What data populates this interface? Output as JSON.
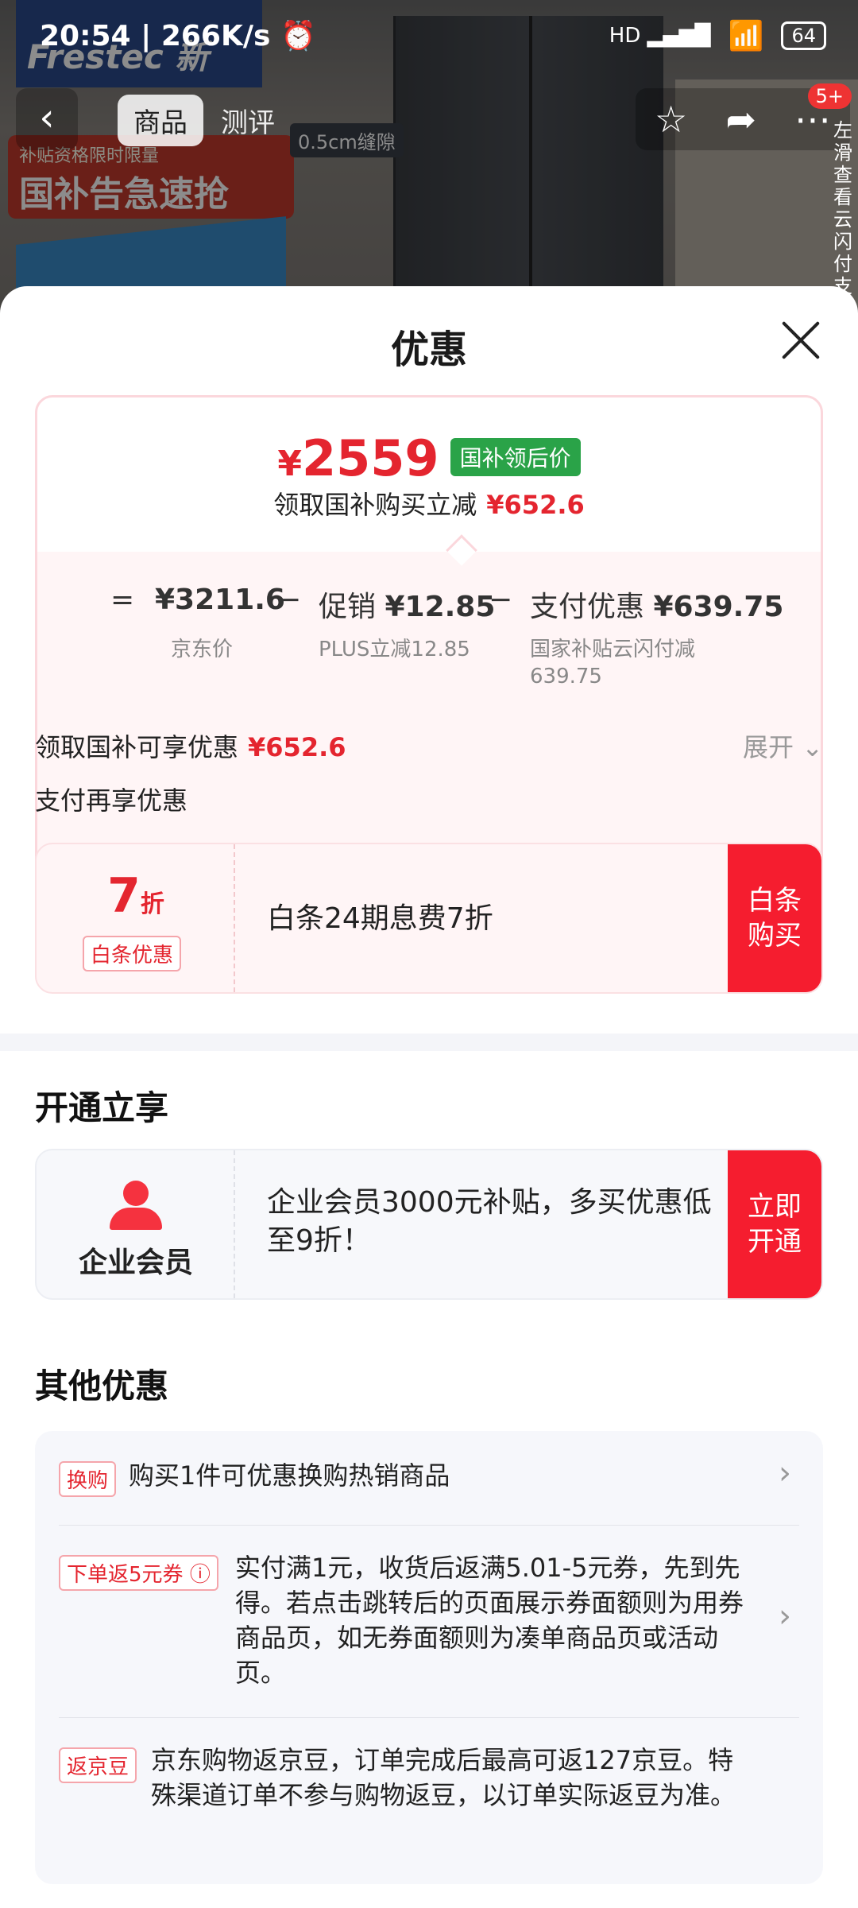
{
  "status_bar": {
    "time": "20:54",
    "speed": "266K/s",
    "signal": "HD",
    "battery": "64"
  },
  "background": {
    "logo": "Frestec 新",
    "banner_small": "补贴资格限时限量",
    "banner_big": "国补告急速抢",
    "seam_label": "0.5cm缝隙",
    "badge_count": "5+",
    "side_hint": "左滑查看云闪付支"
  },
  "nav": {
    "tab_product": "商品",
    "tab_review": "测评"
  },
  "sheet": {
    "title": "优惠",
    "price": {
      "currency": "¥",
      "amount": "2559",
      "tag": "国补领后价",
      "subtitle": "领取国补购买立减",
      "subtitle_amount": "¥652.6"
    },
    "formula": {
      "eq": "=",
      "jd_price": "¥3211.6",
      "jd_label": "京东价",
      "minus1": "−",
      "promo_label": "促销",
      "promo_value": "¥12.85",
      "promo_note": "PLUS立减12.85",
      "minus2": "−",
      "pay_label": "支付优惠",
      "pay_value": "¥639.75",
      "pay_note_line1": "国家补贴云闪付减",
      "pay_note_line2": "639.75"
    },
    "subsidy_row": {
      "label": "领取国补可享优惠",
      "amount": "¥652.6",
      "expand": "展开"
    },
    "pay_again": "支付再享优惠",
    "baitiao": {
      "discount_num": "7",
      "discount_unit": "折",
      "tag": "白条优惠",
      "text": "白条24期息费7折",
      "button": "白条购买"
    },
    "open_section": {
      "title": "开通立享",
      "name": "企业会员",
      "text": "企业会员3000元补贴，多买优惠低至9折！",
      "button": "立即开通"
    },
    "other_section": {
      "title": "其他优惠",
      "items": [
        {
          "tag": "换购",
          "text": "购买1件可优惠换购热销商品"
        },
        {
          "tag": "下单返5元券",
          "text": "实付满1元，收货后返满5.01-5元券，先到先得。若点击跳转后的页面展示券面额则为用券商品页，如无券面额则为凑单商品页或活动页。"
        },
        {
          "tag": "返京豆",
          "text": "京东购物返京豆，订单完成后最高可返127京豆。特殊渠道订单不参与购物返豆，以订单实际返豆为准。"
        }
      ]
    }
  },
  "colors": {
    "accent_red": "#f51d2f",
    "price_red": "#e4252f",
    "tag_green": "#2aa348"
  }
}
